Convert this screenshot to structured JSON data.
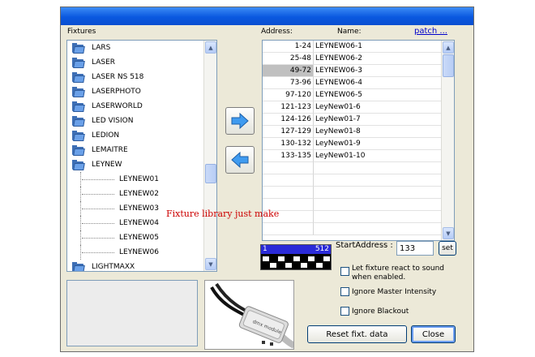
{
  "labels": {
    "fixtures": "Fixtures",
    "address": "Address:",
    "name": "Name:",
    "patch": "patch ..."
  },
  "tree": [
    {
      "label": "LARS",
      "kind": "folder"
    },
    {
      "label": "LASER",
      "kind": "folder"
    },
    {
      "label": "LASER NS 518",
      "kind": "folder"
    },
    {
      "label": "LASERPHOTO",
      "kind": "folder"
    },
    {
      "label": "LASERWORLD",
      "kind": "folder"
    },
    {
      "label": "LED VISION",
      "kind": "folder"
    },
    {
      "label": "LEDION",
      "kind": "folder"
    },
    {
      "label": "LEMAITRE",
      "kind": "folder"
    },
    {
      "label": "LEYNEW",
      "kind": "folder",
      "expanded": true
    },
    {
      "label": "LEYNEW01",
      "kind": "child"
    },
    {
      "label": "LEYNEW02",
      "kind": "child"
    },
    {
      "label": "LEYNEW03",
      "kind": "child"
    },
    {
      "label": "LEYNEW04",
      "kind": "child"
    },
    {
      "label": "LEYNEW05",
      "kind": "child"
    },
    {
      "label": "LEYNEW06",
      "kind": "child"
    },
    {
      "label": "LIGHTMAXX",
      "kind": "folder"
    }
  ],
  "patch_list": [
    {
      "address": "1-24",
      "name": "LEYNEW06-1"
    },
    {
      "address": "25-48",
      "name": "LEYNEW06-2"
    },
    {
      "address": "49-72",
      "name": "LEYNEW06-3",
      "selected": true
    },
    {
      "address": "73-96",
      "name": "LEYNEW06-4"
    },
    {
      "address": "97-120",
      "name": "LEYNEW06-5"
    },
    {
      "address": "121-123",
      "name": "LeyNew01-6"
    },
    {
      "address": "124-126",
      "name": "LeyNew01-7"
    },
    {
      "address": "127-129",
      "name": "LeyNew01-8"
    },
    {
      "address": "130-132",
      "name": "LeyNew01-9"
    },
    {
      "address": "133-135",
      "name": "LeyNew01-10"
    },
    {
      "address": "",
      "name": ""
    },
    {
      "address": "",
      "name": ""
    },
    {
      "address": "",
      "name": ""
    },
    {
      "address": "",
      "name": ""
    },
    {
      "address": "",
      "name": ""
    },
    {
      "address": "",
      "name": ""
    }
  ],
  "dip": {
    "low": "1",
    "high": "512"
  },
  "start_address": {
    "label": "StartAddress :",
    "value": "133",
    "set_label": "set"
  },
  "options": {
    "sound": "Let fixture react to sound when enabled.",
    "master": "Ignore Master Intensity",
    "blackout": "Ignore Blackout"
  },
  "buttons": {
    "reset": "Reset fixt. data",
    "close": "Close"
  },
  "image_text": "dmx module",
  "overlay_note": "Fixture library just make",
  "colors": {
    "title_bar": "#0a58e0",
    "dip_header": "#2a2ad8",
    "note": "#cc0000"
  }
}
